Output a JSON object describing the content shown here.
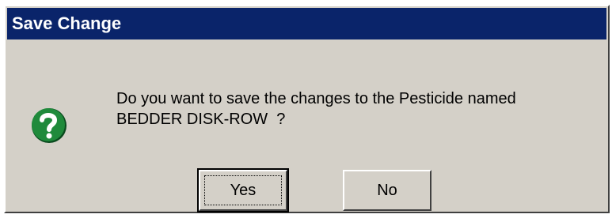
{
  "dialog": {
    "title": "Save Change",
    "icon": "question-icon",
    "message_line1": "Do you want to save the changes to the Pesticide named",
    "message_line2": "BEDDER DISK-ROW  ?",
    "buttons": {
      "yes_label": "Yes",
      "no_label": "No"
    }
  },
  "colors": {
    "titlebar": "#0a246a",
    "dialog_bg": "#d4d0c8",
    "icon_green": "#1f8a3b"
  }
}
